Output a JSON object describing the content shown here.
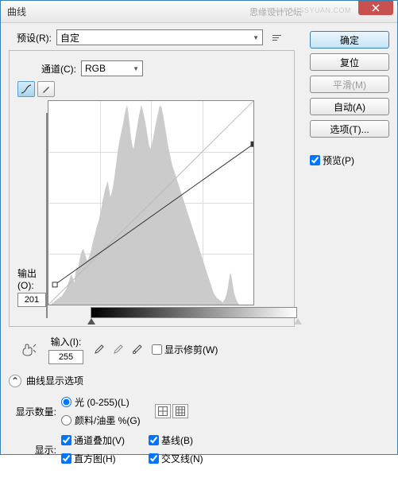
{
  "window": {
    "title": "曲线"
  },
  "watermark": {
    "main": "思缘设计论坛",
    "sub": "WWW.MISSYUAN.COM"
  },
  "preset": {
    "label": "预设(R):",
    "value": "自定"
  },
  "channel": {
    "label": "通道(C):",
    "value": "RGB"
  },
  "output": {
    "label": "输出(O):",
    "value": "201"
  },
  "input": {
    "label": "输入(I):",
    "value": "255"
  },
  "show_clip": {
    "label": "显示修剪(W)"
  },
  "options_header": "曲线显示选项",
  "show_amount": {
    "label": "显示数量:",
    "light": "光 (0-255)(L)",
    "pigment": "颜料/油墨 %(G)"
  },
  "show": {
    "label": "显示:",
    "overlay": "通道叠加(V)",
    "baseline": "基线(B)",
    "histogram": "直方图(H)",
    "intersection": "交叉线(N)"
  },
  "buttons": {
    "ok": "确定",
    "reset": "复位",
    "smooth": "平滑(M)",
    "auto": "自动(A)",
    "options": "选项(T)...",
    "preview": "预览(P)"
  },
  "chart_data": {
    "type": "line",
    "title": "",
    "xlabel": "输入",
    "ylabel": "输出",
    "xlim": [
      0,
      255
    ],
    "ylim": [
      0,
      255
    ],
    "curve_points": [
      {
        "x": 8,
        "y": 25
      },
      {
        "x": 255,
        "y": 201
      }
    ],
    "histogram": [
      0,
      0,
      0,
      1,
      1,
      2,
      2,
      3,
      3,
      4,
      4,
      5,
      6,
      7,
      8,
      10,
      12,
      14,
      15,
      13,
      11,
      16,
      19,
      18,
      22,
      25,
      27,
      28,
      26,
      24,
      22,
      23,
      25,
      27,
      30,
      33,
      35,
      38,
      40,
      42,
      45,
      48,
      52,
      55,
      58,
      60,
      62,
      58,
      54,
      56,
      59,
      63,
      68,
      73,
      78,
      82,
      85,
      88,
      91,
      95,
      98,
      100,
      96,
      90,
      84,
      80,
      78,
      82,
      86,
      90,
      94,
      97,
      100,
      98,
      95,
      92,
      88,
      84,
      80,
      78,
      80,
      83,
      86,
      90,
      93,
      96,
      99,
      100,
      98,
      95,
      91,
      87,
      83,
      79,
      76,
      73,
      70,
      68,
      66,
      64,
      62,
      60,
      58,
      56,
      54,
      52,
      50,
      48,
      46,
      44,
      42,
      40,
      38,
      36,
      34,
      32,
      30,
      28,
      26,
      24,
      22,
      20,
      18,
      16,
      14,
      12,
      10,
      8,
      6,
      5,
      4,
      3,
      3,
      2,
      2,
      1,
      2,
      3,
      5,
      8,
      12,
      16,
      14,
      10,
      6,
      4,
      2,
      1,
      0,
      0,
      0,
      0,
      0,
      0,
      0,
      0,
      0,
      0,
      0,
      0
    ]
  }
}
